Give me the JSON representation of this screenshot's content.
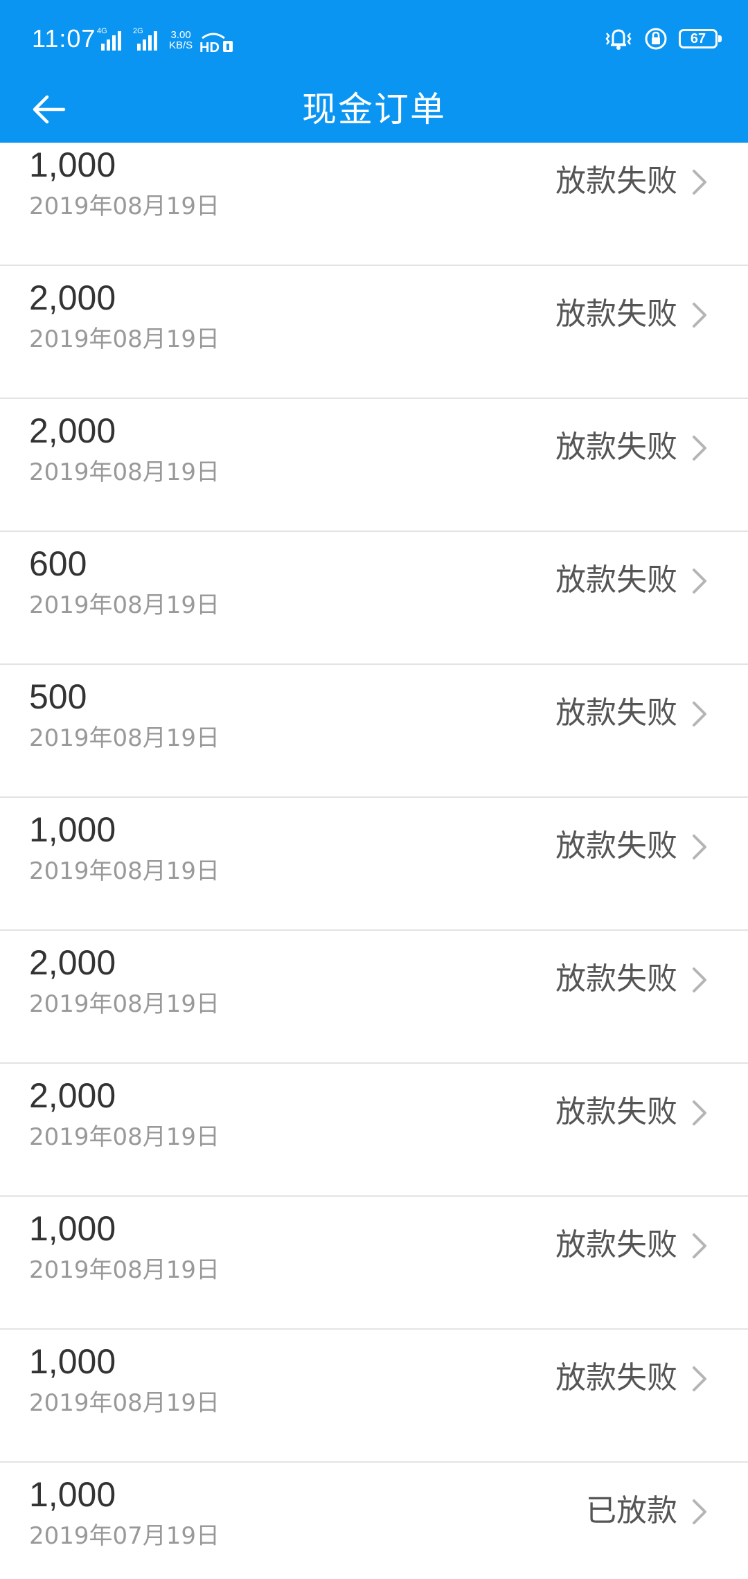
{
  "status_bar": {
    "time": "11:07",
    "network_speed_value": "3.00",
    "network_speed_unit": "KB/S",
    "battery_level": "67"
  },
  "header": {
    "title": "现金订单"
  },
  "orders": [
    {
      "amount": "1,000",
      "date": "2019年08月19日",
      "status": "放款失败"
    },
    {
      "amount": "2,000",
      "date": "2019年08月19日",
      "status": "放款失败"
    },
    {
      "amount": "2,000",
      "date": "2019年08月19日",
      "status": "放款失败"
    },
    {
      "amount": "600",
      "date": "2019年08月19日",
      "status": "放款失败"
    },
    {
      "amount": "500",
      "date": "2019年08月19日",
      "status": "放款失败"
    },
    {
      "amount": "1,000",
      "date": "2019年08月19日",
      "status": "放款失败"
    },
    {
      "amount": "2,000",
      "date": "2019年08月19日",
      "status": "放款失败"
    },
    {
      "amount": "2,000",
      "date": "2019年08月19日",
      "status": "放款失败"
    },
    {
      "amount": "1,000",
      "date": "2019年08月19日",
      "status": "放款失败"
    },
    {
      "amount": "1,000",
      "date": "2019年08月19日",
      "status": "放款失败"
    },
    {
      "amount": "1,000",
      "date": "2019年07月19日",
      "status": "已放款"
    }
  ],
  "colors": {
    "header_bg": "#0a95f2",
    "divider": "#e3e3e3",
    "amount_text": "#333333",
    "date_text": "#999999",
    "status_text": "#555555",
    "chevron": "#b5b5b5"
  }
}
